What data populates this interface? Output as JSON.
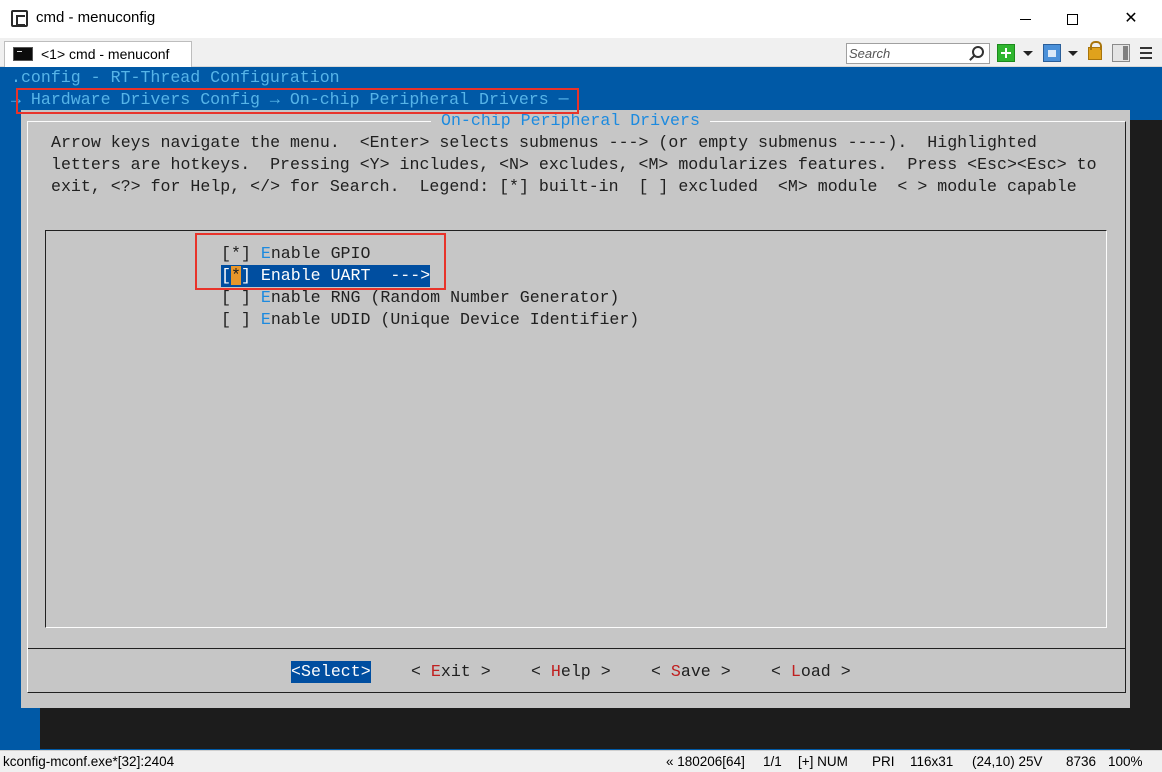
{
  "window": {
    "title": "cmd - menuconfig"
  },
  "tabbar": {
    "tab_label": "<1> cmd - menuconf",
    "search_placeholder": "Search"
  },
  "terminal": {
    "line1": ".config - RT-Thread Configuration",
    "line2": "→ Hardware Drivers Config → On-chip Peripheral Drivers ─",
    "dialog_title": "On-chip Peripheral Drivers",
    "help_lines": [
      "Arrow keys navigate the menu.  <Enter> selects submenus ---> (or empty submenus ----).  Highlighted",
      "letters are hotkeys.  Pressing <Y> includes, <N> excludes, <M> modularizes features.  Press <Esc><Esc> to",
      "exit, <?> for Help, </> for Search.  Legend: [*] built-in  [ ] excluded  <M> module  < > module capable"
    ],
    "items": [
      {
        "check_open": "[",
        "check_mark": "*",
        "check_close": "] ",
        "hotkey": "E",
        "rest": "nable GPIO",
        "selected": false
      },
      {
        "check_open": "[",
        "check_mark": "*",
        "check_close": "] ",
        "hotkey": "E",
        "rest": "nable UART  --->",
        "selected": true
      },
      {
        "check_open": "[",
        "check_mark": " ",
        "check_close": "] ",
        "hotkey": "E",
        "rest": "nable RNG (Random Number Generator)",
        "selected": false
      },
      {
        "check_open": "[",
        "check_mark": " ",
        "check_close": "] ",
        "hotkey": "E",
        "rest": "nable UDID (Unique Device Identifier)",
        "selected": false
      }
    ],
    "buttons": {
      "select": {
        "open": "<",
        "hotkey": "S",
        "rest": "elect",
        "close": ">"
      },
      "exit": {
        "open": "< ",
        "hotkey": "E",
        "rest": "xit",
        "close": " >"
      },
      "help": {
        "open": "< ",
        "hotkey": "H",
        "rest": "elp",
        "close": " >"
      },
      "save": {
        "open": "< ",
        "hotkey": "S",
        "rest": "ave",
        "close": " >"
      },
      "load": {
        "open": "< ",
        "hotkey": "L",
        "rest": "oad",
        "close": " >"
      }
    }
  },
  "statusbar": {
    "process": "kconfig-mconf.exe*[32]:2404",
    "pid": "« 180206[64]",
    "position": "1/1",
    "num": "[+] NUM",
    "pri": "PRI",
    "size": "116x31",
    "cursor": "(24,10) 25V",
    "mem": "8736",
    "zoom": "100%"
  },
  "colors": {
    "terminal_bg": "#0059a6",
    "dialog_bg": "#c6c6c6",
    "selection": "#004ea0",
    "hotkey": "#1c8adf",
    "highlight_annotation": "#e8332a"
  }
}
